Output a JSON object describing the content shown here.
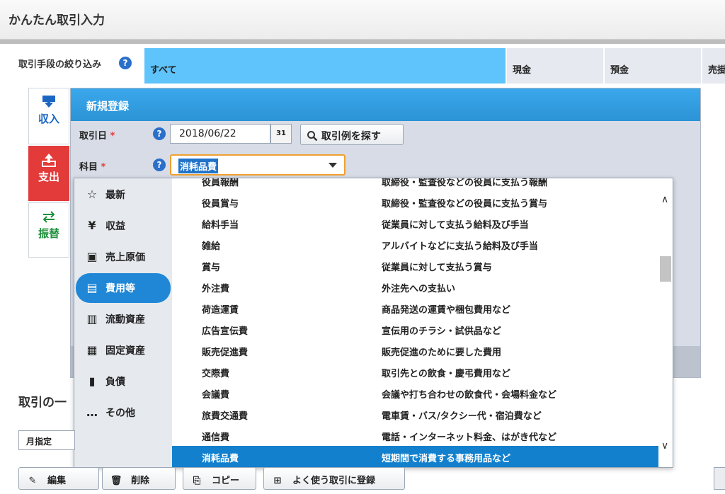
{
  "page": {
    "title": "かんたん取引入力"
  },
  "filter": {
    "label": "取引手段の絞り込み",
    "options": [
      "すべて",
      "現金",
      "預金",
      "売掛"
    ],
    "selected": "すべて"
  },
  "side_tabs": [
    {
      "label": "収入",
      "icon": "income-arrow-icon"
    },
    {
      "label": "支出",
      "icon": "expense-arrow-icon",
      "active": true
    },
    {
      "label": "振替",
      "icon": "transfer-arrows-icon"
    }
  ],
  "form": {
    "heading": "新規登録",
    "date_label": "取引日",
    "date_value": "2018/06/22",
    "calendar_badge": "31",
    "search_example_label": "取引例を探す",
    "account_label": "科目",
    "account_value": "消耗品費",
    "required_mark": "*"
  },
  "dropdown": {
    "categories": [
      {
        "label": "最新",
        "icon": "star-icon"
      },
      {
        "label": "収益",
        "icon": "money-bag-icon"
      },
      {
        "label": "売上原価",
        "icon": "box-icon"
      },
      {
        "label": "費用等",
        "icon": "receipt-icon",
        "selected": true
      },
      {
        "label": "流動資産",
        "icon": "cash-icon"
      },
      {
        "label": "固定資産",
        "icon": "building-icon"
      },
      {
        "label": "負債",
        "icon": "debt-icon"
      },
      {
        "label": "その他",
        "icon": "more-icon"
      }
    ],
    "items": [
      {
        "name": "役員報酬",
        "desc": "取締役・監査役などの役員に支払う報酬"
      },
      {
        "name": "役員賞与",
        "desc": "取締役・監査役などの役員に支払う賞与"
      },
      {
        "name": "給料手当",
        "desc": "従業員に対して支払う給料及び手当"
      },
      {
        "name": "雑給",
        "desc": "アルバイトなどに支払う給料及び手当"
      },
      {
        "name": "賞与",
        "desc": "従業員に対して支払う賞与"
      },
      {
        "name": "外注費",
        "desc": "外注先への支払い"
      },
      {
        "name": "荷造運賃",
        "desc": "商品発送の運賃や梱包費用など"
      },
      {
        "name": "広告宣伝費",
        "desc": "宣伝用のチラシ・試供品など"
      },
      {
        "name": "販売促進費",
        "desc": "販売促進のために要した費用"
      },
      {
        "name": "交際費",
        "desc": "取引先との飲食・慶弔費用など"
      },
      {
        "name": "会議費",
        "desc": "会議や打ち合わせの飲食代・会場料金など"
      },
      {
        "name": "旅費交通費",
        "desc": "電車賃・バス/タクシー代・宿泊費など"
      },
      {
        "name": "通信費",
        "desc": "電話・インターネット料金、はがき代など"
      },
      {
        "name": "消耗品費",
        "desc": "短期間で消費する事務用品など",
        "selected": true
      }
    ]
  },
  "transactions": {
    "title": "取引の一",
    "period_select": "月指定",
    "buttons": {
      "edit": "編集",
      "delete": "削除",
      "copy": "コピー",
      "register_frequent": "よく使う取引に登録"
    }
  }
}
